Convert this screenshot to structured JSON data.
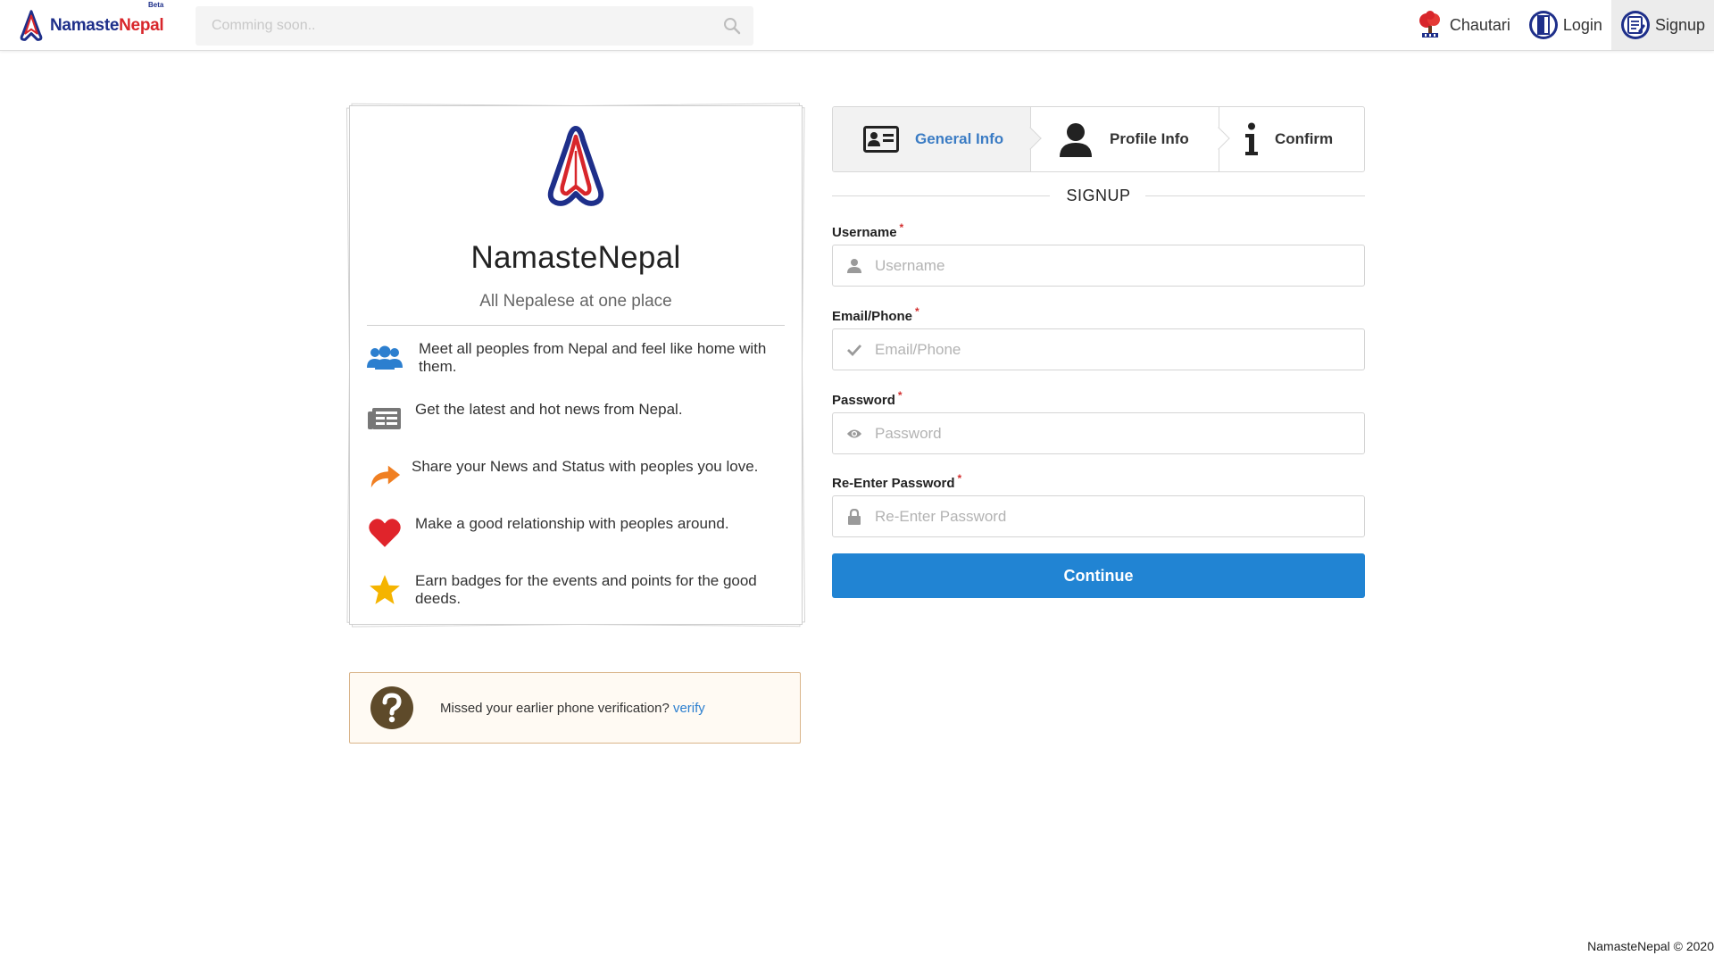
{
  "brand": {
    "name_part1": "Namaste",
    "name_part2": "Nepal",
    "beta": "Beta",
    "colors": {
      "blue": "#1e2f8a",
      "red": "#d8262b"
    }
  },
  "search": {
    "placeholder": "Comming soon..",
    "icon": "search-icon"
  },
  "nav": [
    {
      "label": "Chautari",
      "icon": "tree-icon"
    },
    {
      "label": "Login",
      "icon": "door-icon"
    },
    {
      "label": "Signup",
      "icon": "register-icon",
      "active": true
    }
  ],
  "card": {
    "title": "NamasteNepal",
    "tagline": "All Nepalese at one place",
    "features": [
      {
        "icon": "users-icon",
        "text": "Meet all peoples from Nepal and feel like home with them."
      },
      {
        "icon": "newspaper-icon",
        "text": "Get the latest and hot news from Nepal."
      },
      {
        "icon": "share-icon",
        "text": "Share your News and Status with peoples you love."
      },
      {
        "icon": "heart-icon",
        "text": "Make a good relationship with peoples around."
      },
      {
        "icon": "star-icon",
        "text": "Earn badges for the events and points for the good deeds."
      }
    ]
  },
  "notice": {
    "text": "Missed your earlier phone verification?",
    "link": "verify"
  },
  "steps": [
    {
      "label": "General Info",
      "icon": "id-card-icon",
      "active": true
    },
    {
      "label": "Profile Info",
      "icon": "user-icon"
    },
    {
      "label": "Confirm",
      "icon": "info-icon"
    }
  ],
  "form": {
    "heading": "SIGNUP",
    "required_mark": "*",
    "fields": [
      {
        "label": "Username",
        "placeholder": "Username",
        "icon": "user-icon"
      },
      {
        "label": "Email/Phone",
        "placeholder": "Email/Phone",
        "icon": "check-icon"
      },
      {
        "label": "Password",
        "placeholder": "Password",
        "icon": "eye-icon"
      },
      {
        "label": "Re-Enter Password",
        "placeholder": "Re-Enter Password",
        "icon": "lock-icon"
      }
    ],
    "submit": "Continue"
  },
  "footer": "NamasteNepal © 2020"
}
